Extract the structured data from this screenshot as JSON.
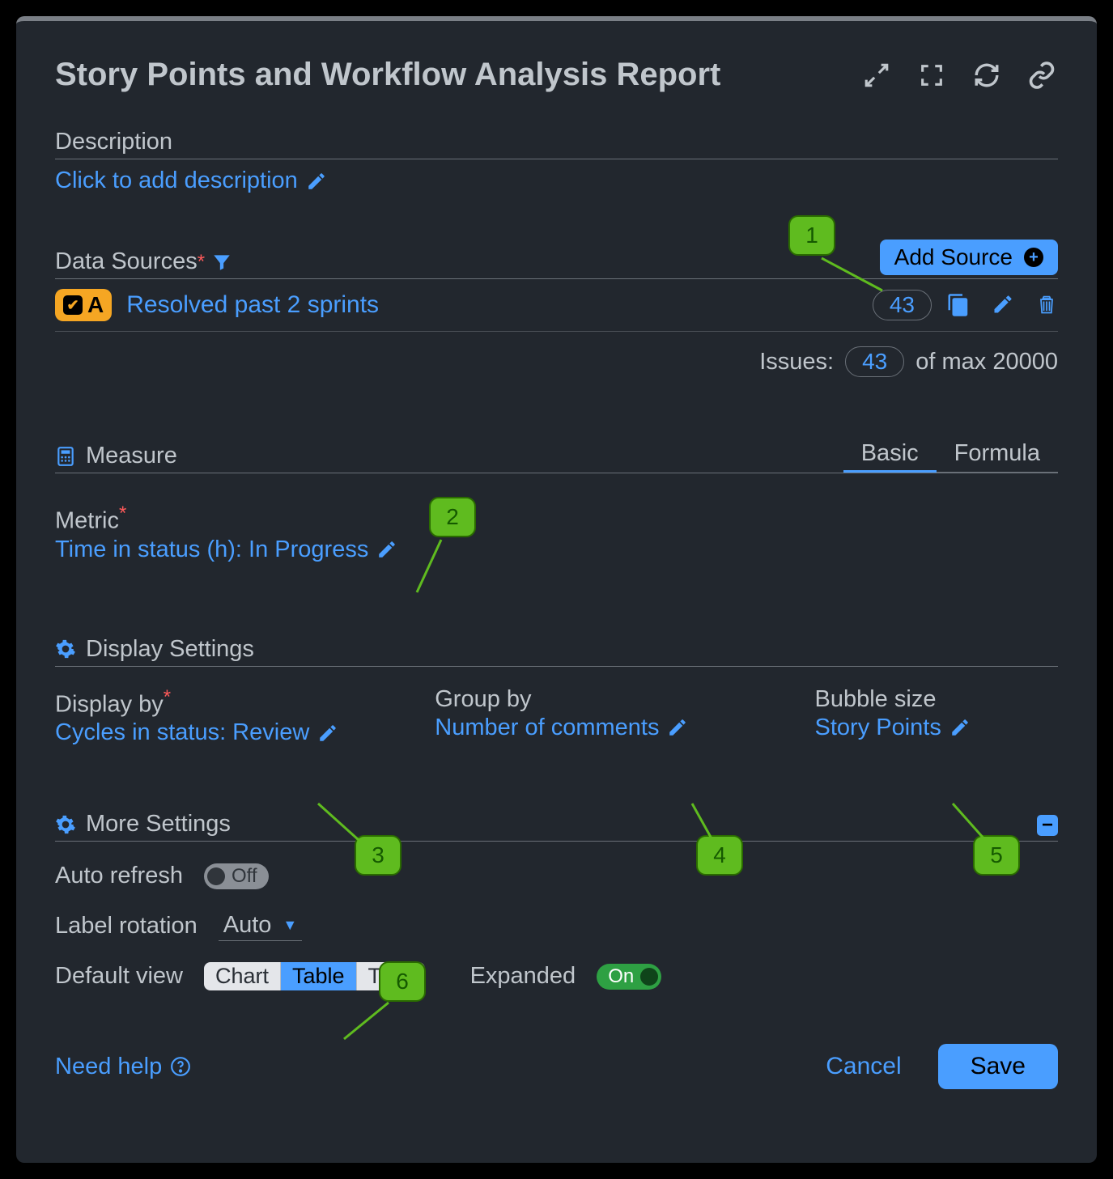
{
  "header": {
    "title": "Story Points and Workflow Analysis Report"
  },
  "description": {
    "label": "Description",
    "placeholder": "Click to add description"
  },
  "dataSources": {
    "label": "Data Sources",
    "addButton": "Add Source",
    "items": [
      {
        "badge": "A",
        "name": "Resolved past 2 sprints",
        "count": "43"
      }
    ],
    "issuesLabel": "Issues:",
    "issuesCount": "43",
    "issuesMax": "of max 20000"
  },
  "measure": {
    "label": "Measure",
    "tabs": {
      "basic": "Basic",
      "formula": "Formula"
    },
    "metricLabel": "Metric",
    "metricValue": "Time in status (h): In Progress"
  },
  "displaySettings": {
    "label": "Display Settings",
    "displayByLabel": "Display by",
    "displayByValue": "Cycles in status: Review",
    "groupByLabel": "Group by",
    "groupByValue": "Number of comments",
    "bubbleSizeLabel": "Bubble size",
    "bubbleSizeValue": "Story Points"
  },
  "moreSettings": {
    "label": "More Settings",
    "autoRefreshLabel": "Auto refresh",
    "autoRefreshValue": "Off",
    "labelRotationLabel": "Label rotation",
    "labelRotationValue": "Auto",
    "defaultViewLabel": "Default view",
    "viewOptions": {
      "chart": "Chart",
      "table": "Table",
      "tiles": "Tiles"
    },
    "expandedLabel": "Expanded",
    "expandedValue": "On"
  },
  "footer": {
    "help": "Need help",
    "cancel": "Cancel",
    "save": "Save"
  },
  "callouts": {
    "c1": "1",
    "c2": "2",
    "c3": "3",
    "c4": "4",
    "c5": "5",
    "c6": "6"
  }
}
